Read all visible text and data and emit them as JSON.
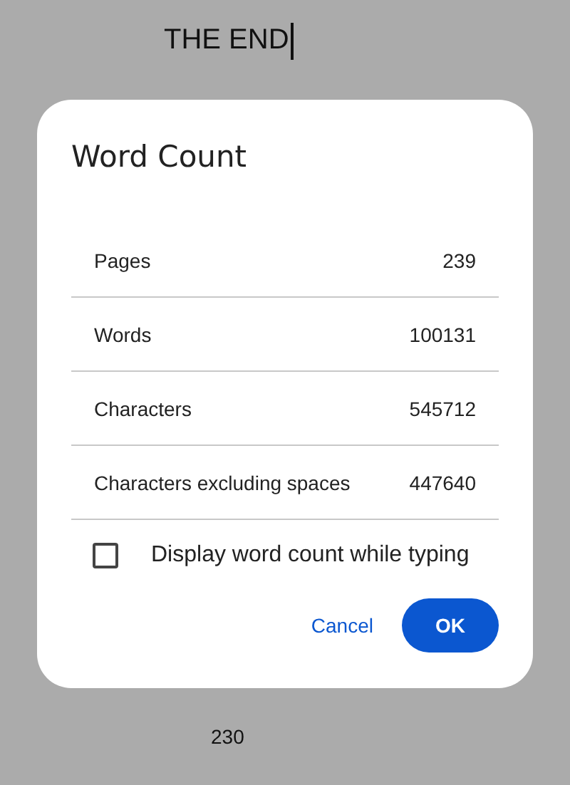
{
  "document": {
    "text": "THE END",
    "page_number": "230"
  },
  "dialog": {
    "title": "Word Count",
    "stats": [
      {
        "label": "Pages",
        "value": "239"
      },
      {
        "label": "Words",
        "value": "100131"
      },
      {
        "label": "Characters",
        "value": "545712"
      },
      {
        "label": "Characters excluding spaces",
        "value": "447640"
      }
    ],
    "option": {
      "label": "Display word count while typing",
      "checked": false
    },
    "buttons": [
      {
        "label": "Cancel",
        "kind": "text"
      },
      {
        "label": "OK",
        "kind": "primary"
      }
    ]
  }
}
